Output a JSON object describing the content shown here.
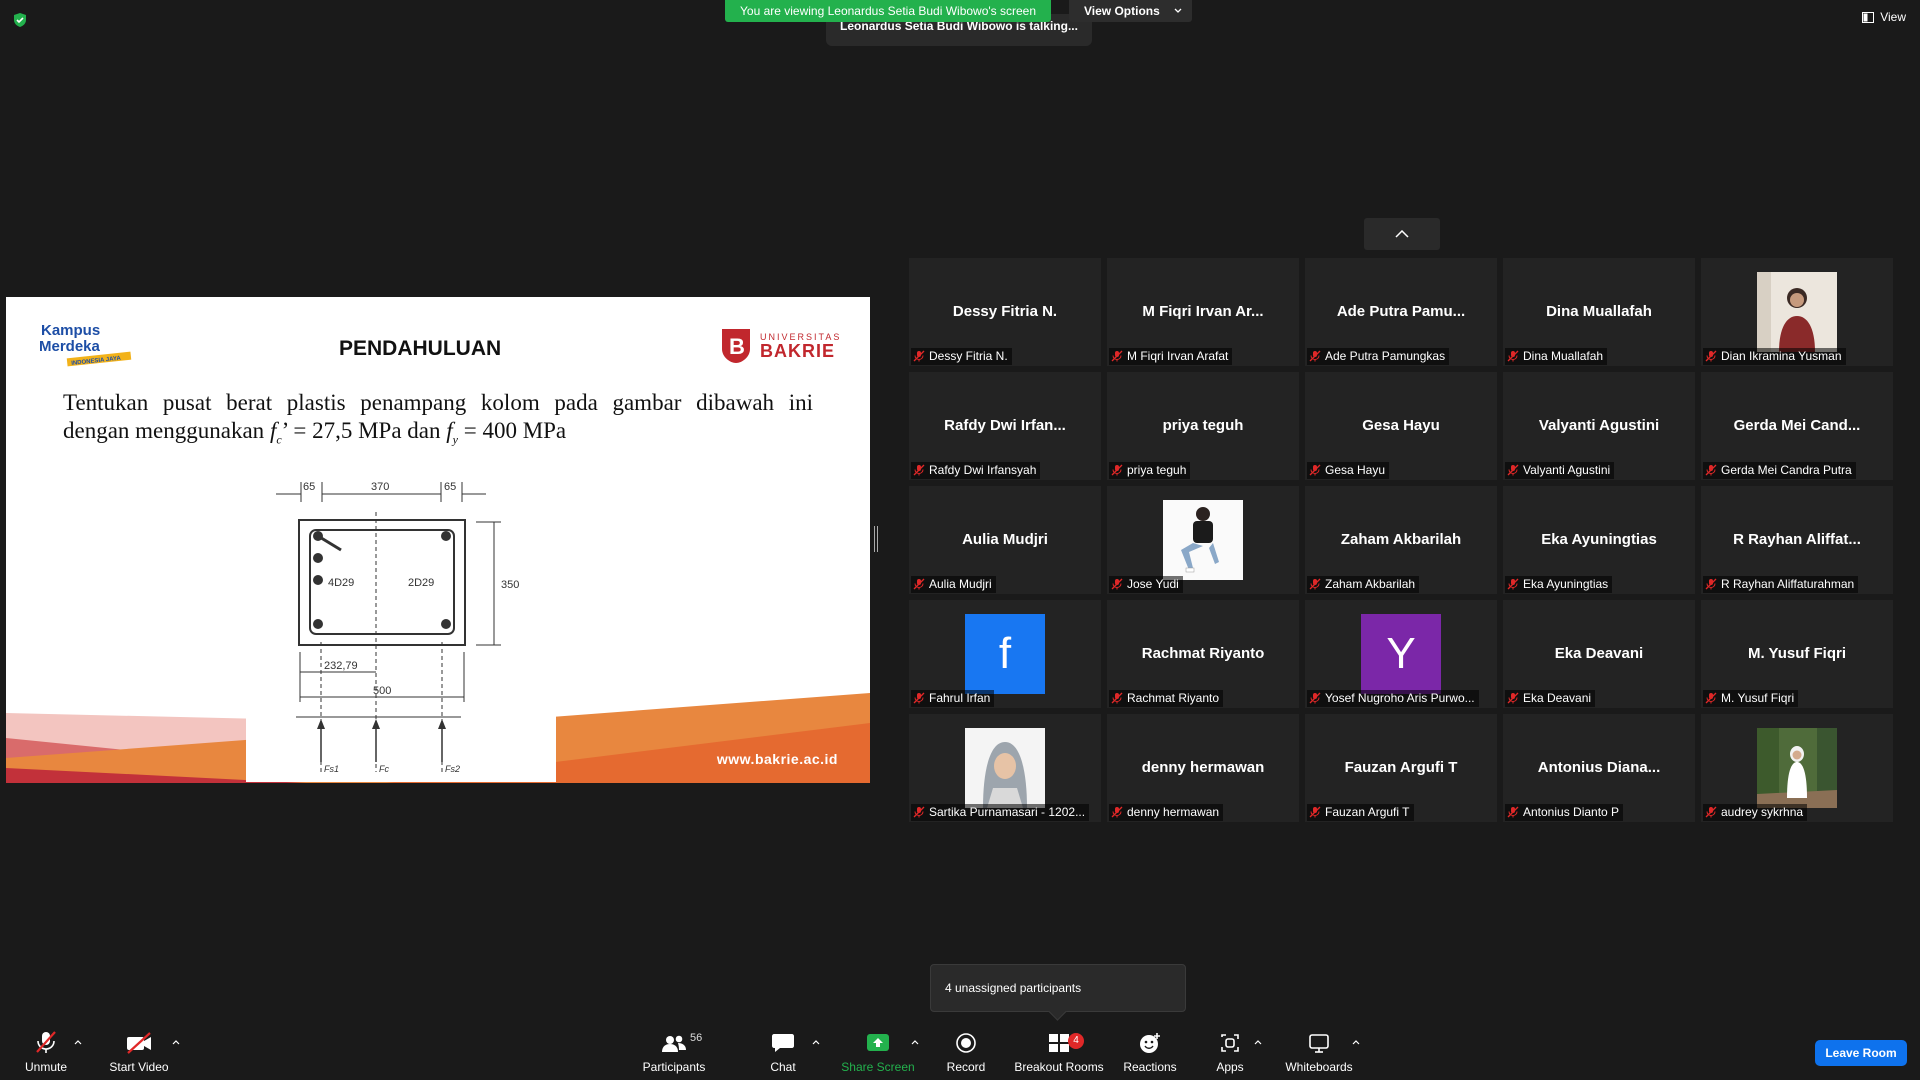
{
  "top": {
    "viewing_banner": "You are viewing Leonardus Setia Budi Wibowo's screen",
    "view_options": "View Options",
    "talking": "Leonardus Setia Budi Wibowo is talking...",
    "view_label": "View"
  },
  "slide": {
    "title": "PENDAHULUAN",
    "logo_left_line1": "Kampus",
    "logo_left_line2": "Merdeka",
    "logo_left_line3": "INDONESIA JAYA",
    "logo_right_line1": "UNIVERSITAS",
    "logo_right_line2": "BAKRIE",
    "problem_line1": "Tentukan pusat berat plastis penampang kolom pada gambar dibawah ini",
    "problem_line2_a": "dengan menggunakan ",
    "problem_line2_b": "f",
    "problem_line2_c": "c",
    "problem_line2_d": "’ = 27,5 MPa dan ",
    "problem_line2_e": "f",
    "problem_line2_f": "y",
    "problem_line2_g": " = 400 MPa",
    "dim_top_left": "65",
    "dim_top_mid": "370",
    "dim_top_right": "65",
    "dim_right": "350",
    "dim_bottom_1": "232,79",
    "dim_bottom_2": "500",
    "rebar_left": "4D29",
    "rebar_right": "2D29",
    "force_1": "Fs1",
    "force_2": "Fc",
    "force_3": "Fs2",
    "url": "www.bakrie.ac.id"
  },
  "gallery": [
    {
      "big": "Dessy Fitria N.",
      "name": "Dessy Fitria N."
    },
    {
      "big": "M Fiqri Irvan Ar...",
      "name": "M Fiqri Irvan Arafat"
    },
    {
      "big": "Ade Putra Pamu...",
      "name": "Ade Putra Pamungkas"
    },
    {
      "big": "Dina Muallafah",
      "name": "Dina Muallafah"
    },
    {
      "big": "",
      "name": "Dian Ikramina Yusman",
      "photo": "woman-red"
    },
    {
      "big": "Rafdy Dwi Irfan...",
      "name": "Rafdy Dwi Irfansyah"
    },
    {
      "big": "priya teguh",
      "name": "priya teguh"
    },
    {
      "big": "Gesa Hayu",
      "name": "Gesa Hayu"
    },
    {
      "big": "Valyanti Agustini",
      "name": "Valyanti Agustini"
    },
    {
      "big": "Gerda Mei Cand...",
      "name": "Gerda Mei Candra Putra"
    },
    {
      "big": "Aulia Mudjri",
      "name": "Aulia Mudjri"
    },
    {
      "big": "",
      "name": "Jose Yudi",
      "photo": "man-sitting"
    },
    {
      "big": "Zaham Akbarilah",
      "name": "Zaham Akbarilah"
    },
    {
      "big": "Eka Ayuningtias",
      "name": "Eka Ayuningtias"
    },
    {
      "big": "R Rayhan Aliffat...",
      "name": "R Rayhan Aliffaturahman"
    },
    {
      "big": "",
      "name": "Fahrul Irfan",
      "photo": "facebook-f",
      "letter": "f",
      "color": "#1877f2"
    },
    {
      "big": "Rachmat Riyanto",
      "name": "Rachmat Riyanto"
    },
    {
      "big": "",
      "name": "Yosef Nugroho Aris Purwo...",
      "photo": "letter-y",
      "letter": "Y",
      "color": "#7b27a8"
    },
    {
      "big": "Eka Deavani",
      "name": "Eka Deavani"
    },
    {
      "big": "M. Yusuf Fiqri",
      "name": "M. Yusuf Fiqri"
    },
    {
      "big": "",
      "name": "Sartika Purnamasari - 1202...",
      "photo": "woman-hijab"
    },
    {
      "big": "denny hermawan",
      "name": "denny hermawan"
    },
    {
      "big": "Fauzan Argufi T",
      "name": "Fauzan Argufi T"
    },
    {
      "big": "Antonius  Diana...",
      "name": "Antonius Dianto P"
    },
    {
      "big": "",
      "name": "audrey sykrhna",
      "photo": "woman-garden"
    }
  ],
  "toast": "4 unassigned participants",
  "toolbar": {
    "unmute": "Unmute",
    "start_video": "Start Video",
    "participants": "Participants",
    "participants_count": "56",
    "chat": "Chat",
    "share_screen": "Share Screen",
    "record": "Record",
    "breakout_rooms": "Breakout Rooms",
    "breakout_badge": "4",
    "reactions": "Reactions",
    "apps": "Apps",
    "whiteboards": "Whiteboards",
    "leave": "Leave Room"
  },
  "colors": {
    "share_green": "#23b14d",
    "leave_blue": "#0e72ed",
    "muted_red": "#e02828"
  }
}
